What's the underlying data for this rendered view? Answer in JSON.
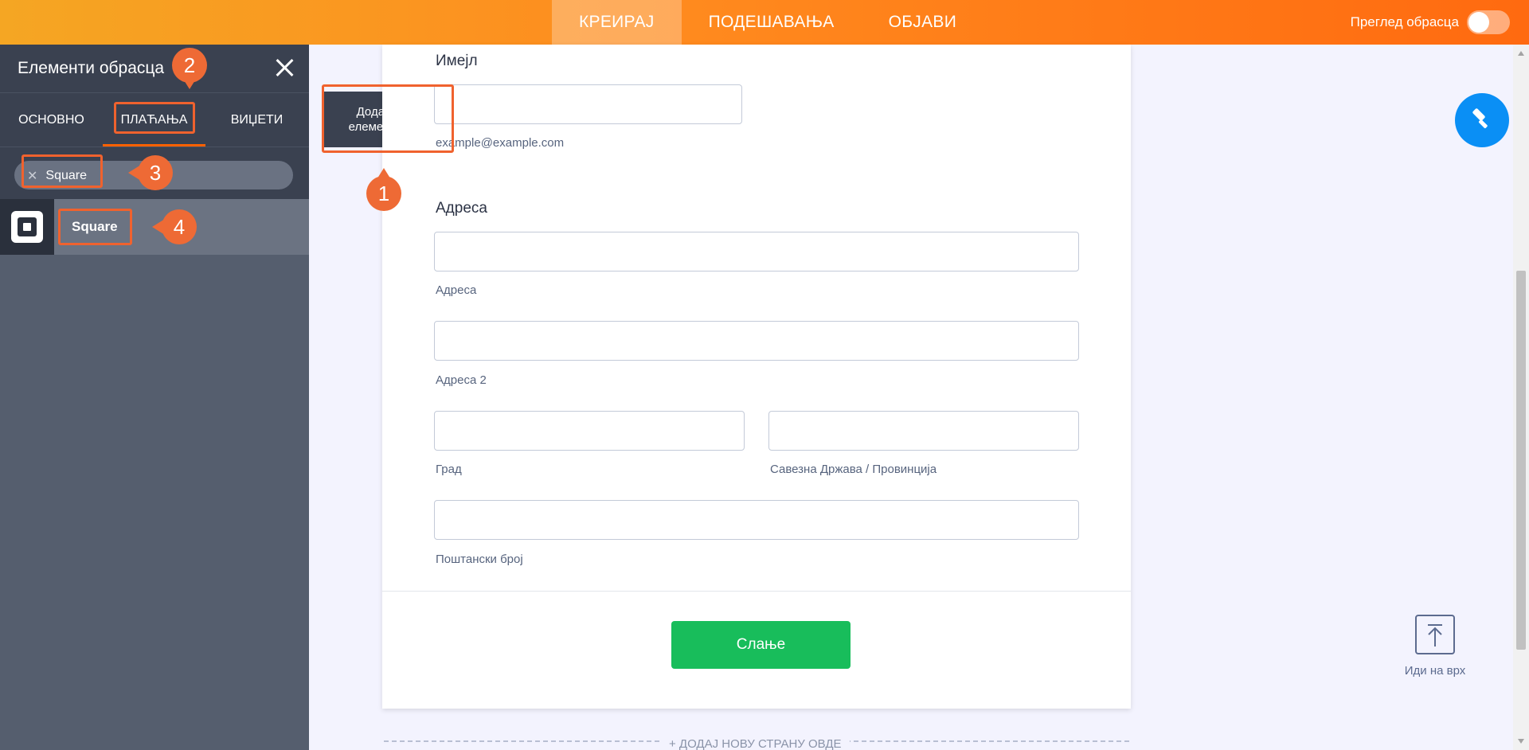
{
  "topbar": {
    "nav": [
      "КРЕИРАЈ",
      "ПОДЕШАВАЊА",
      "ОБЈАВИ"
    ],
    "active_tab": "КРЕИРАЈ",
    "preview_label": "Преглед обрасца",
    "colors": {
      "gradient_start": "#f5a623",
      "gradient_end": "#ff6a10"
    }
  },
  "sidebar": {
    "title": "Елементи обрасца",
    "tabs": [
      "ОСНОВНО",
      "ПЛАЋАЊА",
      "ВИЏЕТИ"
    ],
    "active_tab": "ПЛАЋАЊА",
    "search_chip": "Square",
    "result_label": "Square",
    "result_icon": "square-logo-icon"
  },
  "add_element": {
    "label": "Додај елемент"
  },
  "form": {
    "email": {
      "label": "Имејл",
      "sublabel": "example@example.com"
    },
    "address": {
      "label": "Адреса",
      "line1_sublabel": "Адреса",
      "line2_sublabel": "Адреса 2",
      "city_sublabel": "Град",
      "state_sublabel": "Савезна Држава / Провинција",
      "postal_sublabel": "Поштански број"
    },
    "submit_label": "Слање",
    "add_page_label": "+ ДОДАЈ НОВУ СТРАНУ ОВДЕ"
  },
  "right": {
    "go_top_label": "Иди на врх",
    "paint_icon": "paint-roller-icon"
  },
  "annotations": [
    "1",
    "2",
    "3",
    "4"
  ],
  "colors": {
    "accent": "#ff6100",
    "submit": "#18bd5b",
    "highlight": "#f0622e",
    "paint_button": "#0a8ff5"
  }
}
